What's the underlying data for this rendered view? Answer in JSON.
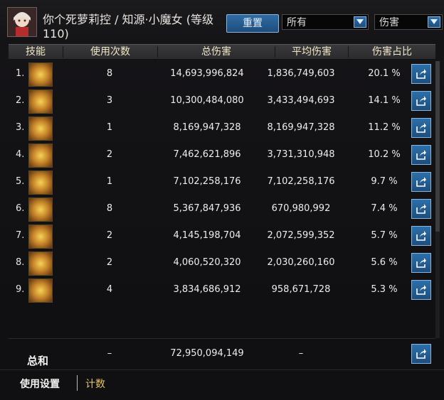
{
  "header": {
    "title": "你个死萝莉控 / 知源·小魔女 (等级110)",
    "reset_label": "重置",
    "filter_value": "所有",
    "metric_value": "伤害"
  },
  "table": {
    "columns": [
      "技能",
      "使用次数",
      "总伤害",
      "平均伤害",
      "伤害占比"
    ],
    "rows": [
      {
        "index": "1.",
        "uses": "8",
        "total": "14,693,996,824",
        "avg": "1,836,749,603",
        "pct": "20.1 %"
      },
      {
        "index": "2.",
        "uses": "3",
        "total": "10,300,484,080",
        "avg": "3,433,494,693",
        "pct": "14.1 %"
      },
      {
        "index": "3.",
        "uses": "1",
        "total": "8,169,947,328",
        "avg": "8,169,947,328",
        "pct": "11.2 %"
      },
      {
        "index": "4.",
        "uses": "2",
        "total": "7,462,621,896",
        "avg": "3,731,310,948",
        "pct": "10.2 %"
      },
      {
        "index": "5.",
        "uses": "1",
        "total": "7,102,258,176",
        "avg": "7,102,258,176",
        "pct": "9.7 %"
      },
      {
        "index": "6.",
        "uses": "8",
        "total": "5,367,847,936",
        "avg": "670,980,992",
        "pct": "7.4 %"
      },
      {
        "index": "7.",
        "uses": "2",
        "total": "4,145,198,704",
        "avg": "2,072,599,352",
        "pct": "5.7 %"
      },
      {
        "index": "8.",
        "uses": "2",
        "total": "4,060,520,320",
        "avg": "2,030,260,160",
        "pct": "5.6 %"
      },
      {
        "index": "9.",
        "uses": "4",
        "total": "3,834,686,912",
        "avg": "958,671,728",
        "pct": "5.3 %"
      }
    ],
    "total": {
      "label": "总和",
      "uses": "–",
      "total": "72,950,094,149",
      "avg": "–"
    }
  },
  "footer": {
    "settings_tab": "使用设置",
    "count_tab": "计数"
  },
  "colors": {
    "accent_blue": "#2c70aa",
    "header_text": "#f1e8c6",
    "count_tab": "#e8c25c"
  }
}
